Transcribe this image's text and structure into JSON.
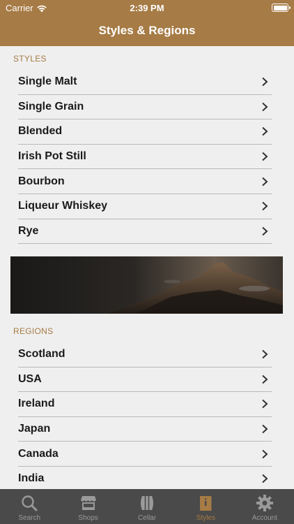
{
  "status_bar": {
    "carrier": "Carrier",
    "time": "2:39 PM"
  },
  "nav": {
    "title": "Styles & Regions"
  },
  "styles": {
    "header": "STYLES",
    "items": [
      {
        "label": "Single Malt"
      },
      {
        "label": "Single Grain"
      },
      {
        "label": "Blended"
      },
      {
        "label": "Irish Pot Still"
      },
      {
        "label": "Bourbon"
      },
      {
        "label": "Liqueur Whiskey"
      },
      {
        "label": "Rye"
      }
    ]
  },
  "regions": {
    "header": "REGIONS",
    "items": [
      {
        "label": "Scotland"
      },
      {
        "label": "USA"
      },
      {
        "label": "Ireland"
      },
      {
        "label": "Japan"
      },
      {
        "label": "Canada"
      },
      {
        "label": "India"
      }
    ]
  },
  "tabs": [
    {
      "label": "Search",
      "icon": "search-icon",
      "active": false
    },
    {
      "label": "Shops",
      "icon": "shop-icon",
      "active": false
    },
    {
      "label": "Cellar",
      "icon": "barrel-icon",
      "active": false
    },
    {
      "label": "Styles",
      "icon": "book-icon",
      "active": true
    },
    {
      "label": "Account",
      "icon": "gear-icon",
      "active": false
    }
  ],
  "colors": {
    "accent": "#a67b45",
    "tab_bar": "#4a4a4a",
    "background": "#efefef"
  }
}
